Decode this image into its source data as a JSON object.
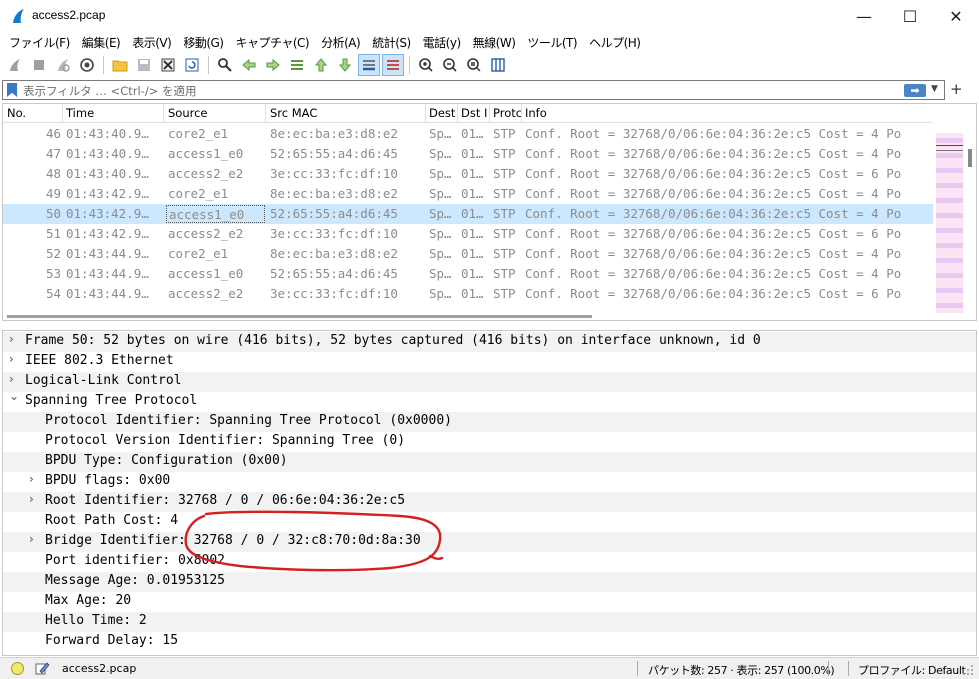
{
  "window": {
    "title": "access2.pcap",
    "minimize_glyph": "—",
    "maximize_glyph": "☐",
    "close_glyph": "✕"
  },
  "menu": [
    {
      "label": "ファイル(F)"
    },
    {
      "label": "編集(E)"
    },
    {
      "label": "表示(V)"
    },
    {
      "label": "移動(G)"
    },
    {
      "label": "キャプチャ(C)"
    },
    {
      "label": "分析(A)"
    },
    {
      "label": "統計(S)"
    },
    {
      "label": "電話(y)"
    },
    {
      "label": "無線(W)"
    },
    {
      "label": "ツール(T)"
    },
    {
      "label": "ヘルプ(H)"
    }
  ],
  "toolbar_icons": [
    "start-capture-icon",
    "stop-capture-icon",
    "restart-capture-icon",
    "capture-options-icon",
    "open-file-icon",
    "save-file-icon",
    "close-file-icon",
    "reload-file-icon",
    "find-packet-icon",
    "go-back-icon",
    "go-forward-icon",
    "go-to-packet-icon",
    "go-first-icon",
    "go-last-icon",
    "auto-scroll-icon",
    "colorize-icon",
    "zoom-in-icon",
    "zoom-out-icon",
    "zoom-normal-icon",
    "resize-columns-icon"
  ],
  "filter": {
    "placeholder": "表示フィルタ … <Ctrl-/> を適用",
    "apply_glyph": "➡",
    "dropdown_glyph": "▼",
    "add_glyph": "+"
  },
  "packet_list": {
    "columns": [
      "No.",
      "Time",
      "Source",
      "Src MAC",
      "Dest",
      "Dst I",
      "Protc",
      "Info"
    ],
    "rows": [
      {
        "no": "46",
        "time": "01:43:40.9…",
        "source": "core2_e1",
        "src_mac": "8e:ec:ba:e3:d8:e2",
        "dest": "Sp…",
        "dst": "01…",
        "proto": "STP",
        "info": "Conf. Root = 32768/0/06:6e:04:36:2e:c5   Cost = 4  Po"
      },
      {
        "no": "47",
        "time": "01:43:40.9…",
        "source": "access1_e0",
        "src_mac": "52:65:55:a4:d6:45",
        "dest": "Sp…",
        "dst": "01…",
        "proto": "STP",
        "info": "Conf. Root = 32768/0/06:6e:04:36:2e:c5   Cost = 4  Po"
      },
      {
        "no": "48",
        "time": "01:43:40.9…",
        "source": "access2_e2",
        "src_mac": "3e:cc:33:fc:df:10",
        "dest": "Sp…",
        "dst": "01…",
        "proto": "STP",
        "info": "Conf. Root = 32768/0/06:6e:04:36:2e:c5   Cost = 6  Po"
      },
      {
        "no": "49",
        "time": "01:43:42.9…",
        "source": "core2_e1",
        "src_mac": "8e:ec:ba:e3:d8:e2",
        "dest": "Sp…",
        "dst": "01…",
        "proto": "STP",
        "info": "Conf. Root = 32768/0/06:6e:04:36:2e:c5   Cost = 4  Po"
      },
      {
        "no": "50",
        "time": "01:43:42.9…",
        "source": "access1_e0",
        "src_mac": "52:65:55:a4:d6:45",
        "dest": "Sp…",
        "dst": "01…",
        "proto": "STP",
        "info": "Conf. Root = 32768/0/06:6e:04:36:2e:c5   Cost = 4  Po",
        "selected": true
      },
      {
        "no": "51",
        "time": "01:43:42.9…",
        "source": "access2_e2",
        "src_mac": "3e:cc:33:fc:df:10",
        "dest": "Sp…",
        "dst": "01…",
        "proto": "STP",
        "info": "Conf. Root = 32768/0/06:6e:04:36:2e:c5   Cost = 6  Po"
      },
      {
        "no": "52",
        "time": "01:43:44.9…",
        "source": "core2_e1",
        "src_mac": "8e:ec:ba:e3:d8:e2",
        "dest": "Sp…",
        "dst": "01…",
        "proto": "STP",
        "info": "Conf. Root = 32768/0/06:6e:04:36:2e:c5   Cost = 4  Po"
      },
      {
        "no": "53",
        "time": "01:43:44.9…",
        "source": "access1_e0",
        "src_mac": "52:65:55:a4:d6:45",
        "dest": "Sp…",
        "dst": "01…",
        "proto": "STP",
        "info": "Conf. Root = 32768/0/06:6e:04:36:2e:c5   Cost = 4  Po"
      },
      {
        "no": "54",
        "time": "01:43:44.9…",
        "source": "access2_e2",
        "src_mac": "3e:cc:33:fc:df:10",
        "dest": "Sp…",
        "dst": "01…",
        "proto": "STP",
        "info": "Conf. Root = 32768/0/06:6e:04:36:2e:c5   Cost = 6  Po"
      }
    ]
  },
  "details": [
    {
      "text": "Frame 50: 52 bytes on wire (416 bits), 52 bytes captured (416 bits) on interface unknown, id 0",
      "arrow": "›",
      "level": 0
    },
    {
      "text": "IEEE 802.3 Ethernet",
      "arrow": "›",
      "level": 0
    },
    {
      "text": "Logical-Link Control",
      "arrow": "›",
      "level": 0
    },
    {
      "text": "Spanning Tree Protocol",
      "arrow": "⌄",
      "level": 0
    },
    {
      "text": "Protocol Identifier: Spanning Tree Protocol (0x0000)",
      "arrow": "",
      "level": 1
    },
    {
      "text": "Protocol Version Identifier: Spanning Tree (0)",
      "arrow": "",
      "level": 1
    },
    {
      "text": "BPDU Type: Configuration (0x00)",
      "arrow": "",
      "level": 1
    },
    {
      "text": "BPDU flags: 0x00",
      "arrow": "›",
      "level": 1
    },
    {
      "text": "Root Identifier: 32768 / 0 / 06:6e:04:36:2e:c5",
      "arrow": "›",
      "level": 1
    },
    {
      "text": "Root Path Cost: 4",
      "arrow": "",
      "level": 1
    },
    {
      "text": "Bridge Identifier: 32768 / 0 / 32:c8:70:0d:8a:30",
      "arrow": "›",
      "level": 1
    },
    {
      "text": "Port identifier: 0x8002",
      "arrow": "",
      "level": 1
    },
    {
      "text": "Message Age: 0.01953125",
      "arrow": "",
      "level": 1
    },
    {
      "text": "Max Age: 20",
      "arrow": "",
      "level": 1
    },
    {
      "text": "Hello Time: 2",
      "arrow": "",
      "level": 1
    },
    {
      "text": "Forward Delay: 15",
      "arrow": "",
      "level": 1
    }
  ],
  "status": {
    "file": "access2.pcap",
    "packets": "パケット数: 257 · 表示: 257 (100.0%)",
    "profile": "プロファイル: Default"
  },
  "colors": {
    "selected_row": "#cce8ff",
    "annotation": "#d42020",
    "stp_row_fg": "#8c8c8c",
    "minimap_a": "#e8c8f0",
    "minimap_b": "#fde4f4"
  }
}
